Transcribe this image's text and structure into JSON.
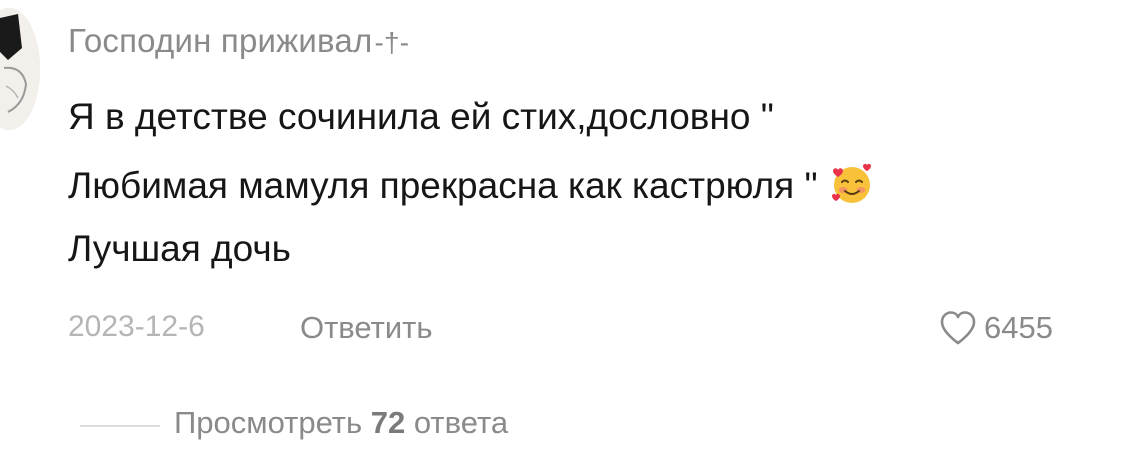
{
  "comment": {
    "username": "Господин приживал",
    "username_symbol": "-†-",
    "text_lines": [
      "Я в детстве сочинила ей стих,дословно \"",
      "Любимая мамуля прекрасна как кастрюля \"",
      "Лучшая дочь"
    ],
    "emoji": "smiling-face-with-hearts",
    "date": "2023-12-6",
    "reply_label": "Ответить",
    "likes": "6455",
    "view_replies": {
      "prefix": "Просмотреть",
      "count": "72",
      "suffix": "ответа"
    }
  },
  "icons": {
    "heart": "heart-outline-icon"
  }
}
